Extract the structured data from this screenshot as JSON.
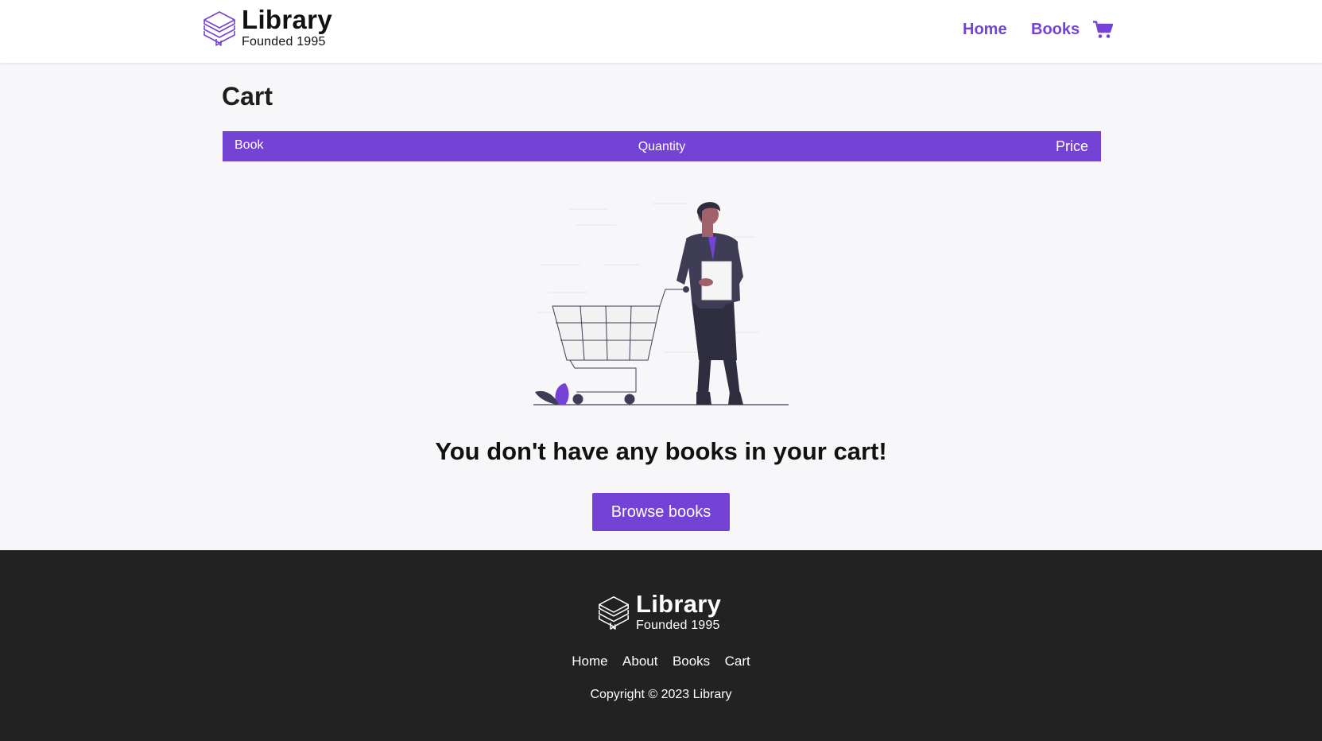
{
  "header": {
    "logo": {
      "title": "Library",
      "subtitle": "Founded 1995",
      "icon": "books-stack-icon"
    },
    "nav": [
      {
        "label": "Home"
      },
      {
        "label": "Books"
      }
    ],
    "cart_icon": "cart-icon"
  },
  "main": {
    "title": "Cart",
    "table_header": {
      "book": "Book",
      "quantity": "Quantity",
      "price": "Price"
    },
    "empty_message": "You don't have any books in your cart!",
    "browse_button": "Browse books",
    "illustration": "person-with-shopping-cart-illustration"
  },
  "footer": {
    "logo": {
      "title": "Library",
      "subtitle": "Founded 1995"
    },
    "links": [
      "Home",
      "About",
      "Books",
      "Cart"
    ],
    "copyright": "Copyright © 2023 Library"
  },
  "colors": {
    "accent": "#7443d6",
    "footer_bg": "#222222",
    "page_bg": "#f7f7f9"
  }
}
